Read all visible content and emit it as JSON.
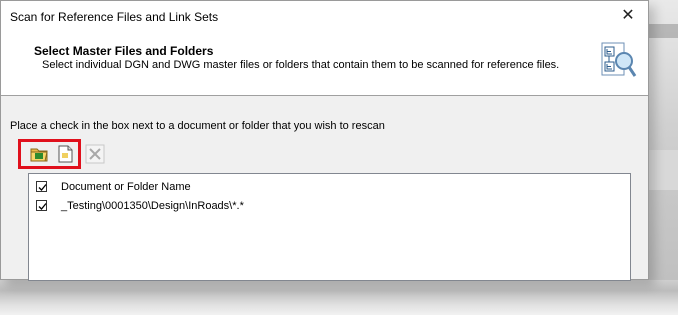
{
  "window": {
    "title": "Scan for Reference Files and Link Sets",
    "close_glyph": "✕"
  },
  "header": {
    "title": "Select Master Files and Folders",
    "subtitle": "Select individual DGN and DWG master files or folders that contain them to be scanned for reference files.",
    "icon": "reference-tree-magnifier-icon"
  },
  "instruction": "Place a check in the box next to a document or folder that you wish to rescan",
  "toolbar": {
    "buttons": [
      {
        "icon": "add-folder-icon",
        "enabled": true
      },
      {
        "icon": "add-document-icon",
        "enabled": true
      },
      {
        "icon": "remove-icon",
        "enabled": false
      }
    ],
    "highlight_color": "#e0101c"
  },
  "list": {
    "header": {
      "label": "Document or Folder Name",
      "checked": true
    },
    "items": [
      {
        "label": "_Testing\\0001350\\Design\\InRoads\\*.*",
        "checked": true
      }
    ]
  }
}
